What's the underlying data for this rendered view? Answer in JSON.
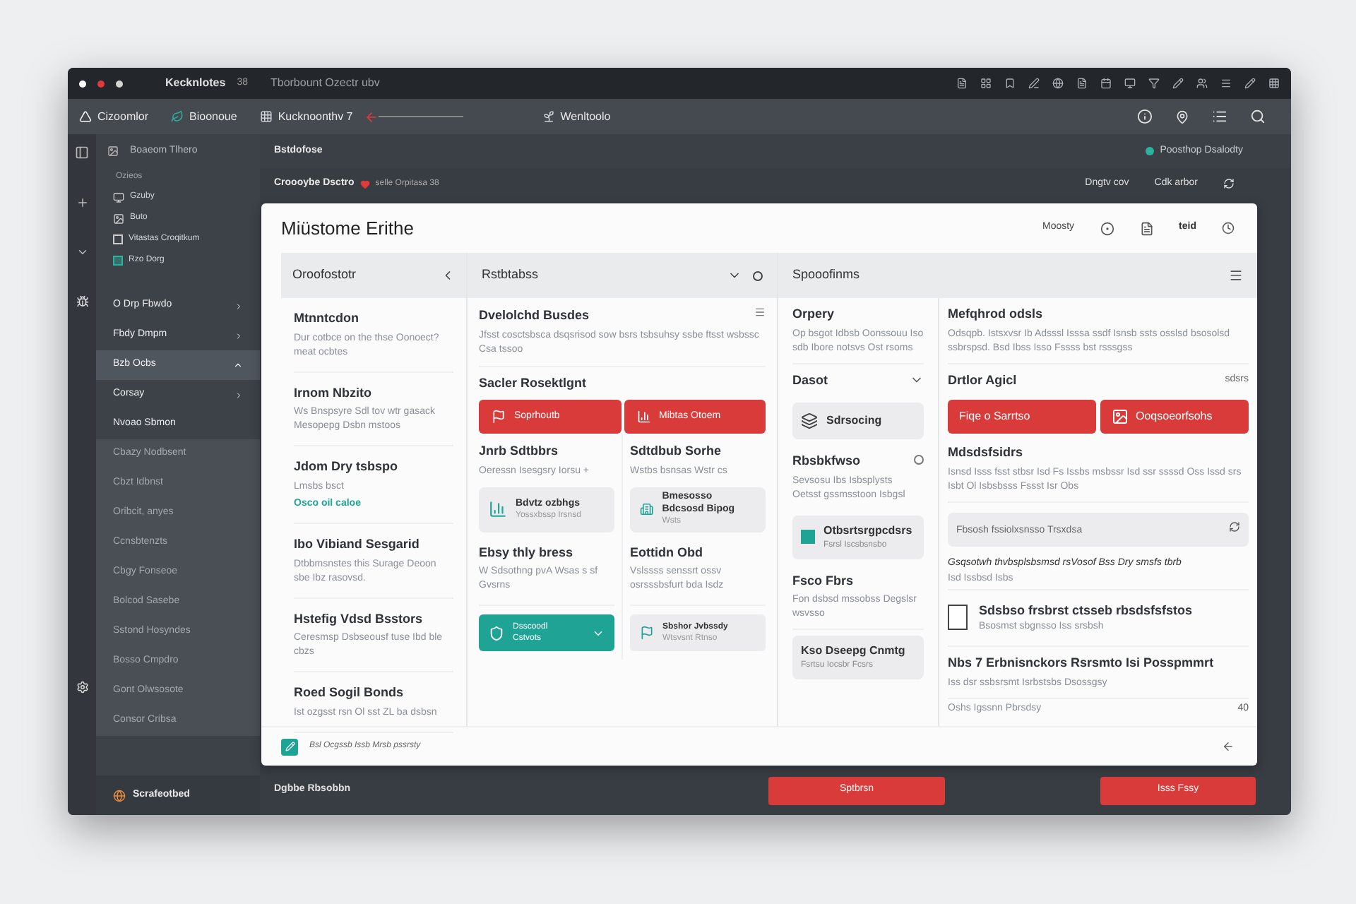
{
  "window": {
    "dots": [
      {
        "color": "#ffffff"
      },
      {
        "color": "#e03a3a"
      },
      {
        "color": "#d4d4d4"
      }
    ],
    "app_name": "Kecknlotes",
    "badge": "38",
    "title": "Tborbount Ozectr ubv"
  },
  "toolbar": {
    "items": [
      {
        "label": "Cizoomlor"
      },
      {
        "label": "Bioonoue"
      },
      {
        "label": "Kucknoonthv 7"
      },
      {
        "label": "Wenltoolo"
      }
    ]
  },
  "sidebar": {
    "header": "Boaeom Tlhero",
    "group_label": "Ozieos",
    "tools": [
      {
        "label": "Gzuby",
        "kind": "icon"
      },
      {
        "label": "Buto",
        "kind": "icon"
      },
      {
        "label": "Vitastas Croqitkum",
        "kind": "checkbox",
        "checked": false
      },
      {
        "label": "Rzo Dorg",
        "kind": "checkbox",
        "checked": true
      }
    ],
    "items": [
      {
        "label": "O Drp Fbwdo",
        "kind": "nav",
        "selected": false,
        "expanded": false
      },
      {
        "label": "Fbdy Dmpm",
        "kind": "nav",
        "selected": false,
        "expanded": false
      },
      {
        "label": "Bzb Ocbs",
        "kind": "nav",
        "selected": true,
        "expanded": true
      },
      {
        "label": "Corsay",
        "kind": "nav",
        "selected": false,
        "expanded": false
      },
      {
        "label": "Nvoao Sbmon",
        "kind": "nav",
        "selected": false
      },
      {
        "label": "Cbazy Nodbsent",
        "kind": "sub"
      },
      {
        "label": "Cbzt Idbnst",
        "kind": "sub"
      },
      {
        "label": "Oribcit, anyes",
        "kind": "sub"
      },
      {
        "label": "Ccnsbtenzts",
        "kind": "sub"
      },
      {
        "label": "Cbgy Fonseoe",
        "kind": "sub"
      },
      {
        "label": "Bolcod Sasebe",
        "kind": "sub"
      },
      {
        "label": "Sstond Hosyndes",
        "kind": "sub"
      },
      {
        "label": "Bosso Cmpdro",
        "kind": "sub"
      },
      {
        "label": "Gont Olwsosote",
        "kind": "sub"
      },
      {
        "label": "Consor Cribsa",
        "kind": "sub"
      }
    ],
    "footer": "Scrafeotbed"
  },
  "header": {
    "title": "Bstdofose",
    "status": "Poosthop Dsalodty",
    "breadcrumb": "Croooybe Dsctro",
    "breadcrumb_meta": "selle Orpitasa 38",
    "sort": "Dngtv cov",
    "action": "Cdk arbor"
  },
  "modal": {
    "title": "Miüstome Erithe",
    "mode": "Moosty",
    "user": "teid",
    "panel_a": {
      "title": "Oroofostotr",
      "items": [
        {
          "title": "Mtnntcdon",
          "description": "Dur cotbce on the thse Oonoect? meat ocbtes"
        },
        {
          "title": "Irnom Nbzito",
          "description": "Ws Bnspsyre Sdl tov wtr gasack Mesopepg Dsbn mstoos"
        },
        {
          "title": "Jdom Dry tsbspo",
          "description": "Lmsbs bsct",
          "link": "Osco oil caloe"
        },
        {
          "title": "Ibo Vibiand Sesgarid",
          "description": "Dtbbmsnstes this Surage Deoon sbe Ibz rasovsd."
        },
        {
          "title": "Hstefig Vdsd Bsstors",
          "description": "Ceresmsp Dsbseousf tuse Ibd ble cbzs"
        },
        {
          "title": "Roed Sogil Bonds",
          "description": "Ist ozgsst rsn Ol sst ZL ba dsbsn"
        }
      ]
    },
    "panel_b": {
      "title": "Rstbtabss",
      "section": {
        "title": "Dvelolchd Busdes",
        "description": "Jfsst cosctsbsca dsqsrisod sow bsrs tsbsuhsy ssbe ftsst wsbssc Csa tssoo"
      },
      "subheading": "Sacler Rosektlgnt",
      "red_buttons": [
        {
          "label": "Soprhoutb"
        },
        {
          "label": "Mibtas Otoem"
        }
      ],
      "columns": [
        {
          "title": "Jnrb Sdtbbrs",
          "description": "Oeressn Isesgsry Iorsu +",
          "card": {
            "title": "Bdvtz ozbhgs",
            "subtitle": "Yossxbssp Irsnsd"
          },
          "item": {
            "title": "Ebsy thly bress",
            "description": "W Sdsothng pvA Wsas s sf Gvsrns"
          },
          "bottom": {
            "kind": "primary",
            "title": "Dsscoodl",
            "subtitle": "Cstvots"
          }
        },
        {
          "title": "Sdtdbub Sorhe",
          "description": "Wstbs bsnsas Wstr cs",
          "card": {
            "title": "Bmesosso Bdcsosd Bipog",
            "subtitle": "Wsts"
          },
          "item": {
            "title": "Eottidn Obd",
            "description": "Vslssss senssrt ossv osrsssbsfurt bda Isdz"
          },
          "bottom": {
            "kind": "card",
            "title": "Sbshor Jvbssdy",
            "subtitle": "Wtsvsnt Rtnso"
          }
        }
      ]
    },
    "panel_c": {
      "title": "Spooofinms",
      "left": [
        {
          "kind": "text",
          "title": "Orpery",
          "description": "Op bsgot Idbsb Oonssouu Iso sdb Ibore notsvs Ost rsoms"
        },
        {
          "kind": "dropdown",
          "title": "Dasot"
        },
        {
          "kind": "card",
          "title": "Sdrsocing"
        },
        {
          "kind": "radio",
          "title": "Rbsbkfwso",
          "description": "Sevsosu Ibs Isbsplysts Oetsst gssmsstoon Isbgsl",
          "selected": false
        },
        {
          "kind": "card",
          "title": "Otbsrtsrgpcdsrs",
          "subtitle": "Fsrsl Iscsbsnsbo"
        },
        {
          "kind": "text",
          "title": "Fsco Fbrs",
          "description": "Fon dsbsd mssobss Degslsr wsvsso"
        },
        {
          "kind": "card",
          "title": "Kso Dseepg Cnmtg",
          "subtitle": "Fsrtsu Iocsbr Fcsrs"
        }
      ],
      "right": [
        {
          "kind": "text",
          "title": "Mefqhrod odsls",
          "description": "Odsqpb. Istsxvsr Ib Adsssl Isssa ssdf Isnsb ssts osslsd bsosolsd ssbrspsd. Bsd Ibss Isso Fssss bst rsssgss"
        },
        {
          "kind": "dropdown",
          "title": "Drtlor Agicl",
          "value": "sdsrs"
        },
        {
          "kind": "buttons",
          "buttons": [
            {
              "label": "Fiqe o Sarrtso"
            },
            {
              "label": "Ooqsoeorfsohs"
            }
          ]
        },
        {
          "kind": "text",
          "title": "Mdsdsfsidrs",
          "description": "Isnsd Isss fsst stbsr Isd Fs Issbs msbssr Isd ssr ssssd Oss Issd srs Isbt Ol Isbsbsss Fssst Isr Obs"
        },
        {
          "kind": "field",
          "placeholder": "Fbsosh fssiolxsnsso Trsxdsa"
        },
        {
          "kind": "note",
          "title": "Gsqsotwh thvbsplsbsmsd rsVosof Bss Dry smsfs tbrb",
          "description": "Isd Issbsd Isbs"
        },
        {
          "kind": "checkbox",
          "title": "Sdsbso frsbrst ctsseb rbsdsfsfstos",
          "description": "Bsosmst sbgnsso Iss srsbsh",
          "checked": false
        },
        {
          "kind": "text",
          "title": "Nbs 7 Erbnisnckors Rsrsmto Isi Posspmmrt",
          "description": "Iss dsr ssbsrsmt Isrbstsbs Dsossgsy"
        },
        {
          "kind": "meta",
          "title": "Oshs Igssnn Pbrsdsy",
          "value": "40"
        }
      ]
    },
    "footer_note": "Bsl Ocgssb Issb Mrsb pssrsty"
  },
  "bottom_bar": {
    "label": "Dgbbe Rbsobbn",
    "buttons": [
      {
        "label": "Sptbrsn"
      },
      {
        "label": "Isss Fssy"
      }
    ]
  }
}
